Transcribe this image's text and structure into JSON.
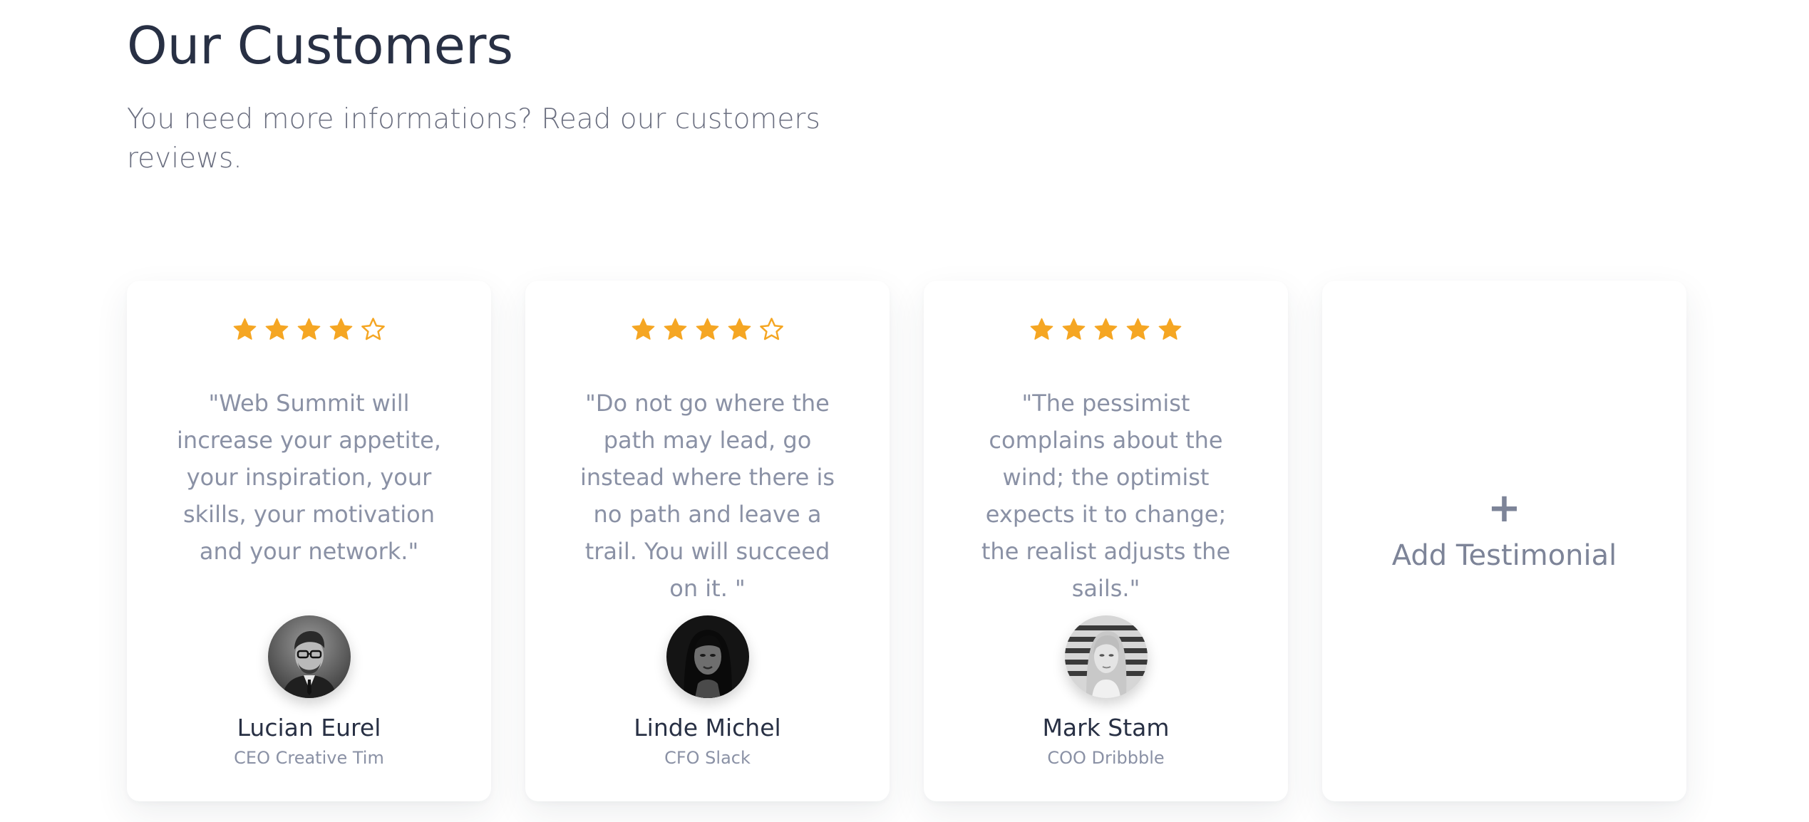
{
  "section": {
    "title": "Our Customers",
    "subtitle": "You need more informations? Read our customers reviews."
  },
  "colors": {
    "star": "#f5a623",
    "title": "#283044",
    "muted": "#8a91a5"
  },
  "testimonials": [
    {
      "rating": 4,
      "max_rating": 5,
      "quote": "\"Web Summit will increase your appetite, your inspiration, your skills, your motivation and your network.\"",
      "name": "Lucian Eurel",
      "role": "CEO Creative Tim",
      "avatar_icon": "avatar-man-glasses"
    },
    {
      "rating": 4,
      "max_rating": 5,
      "quote": "\"Do not go where the path may lead, go instead where there is no path and leave a trail. You will succeed on it. \"",
      "name": "Linde Michel",
      "role": "CFO Slack",
      "avatar_icon": "avatar-woman-dark"
    },
    {
      "rating": 5,
      "max_rating": 5,
      "quote": "\"The pessimist complains about the wind; the optimist expects it to change; the realist adjusts the sails.\"",
      "name": "Mark Stam",
      "role": "COO Dribbble",
      "avatar_icon": "avatar-woman-blonde"
    }
  ],
  "add_card": {
    "icon": "plus-icon",
    "plus_glyph": "+",
    "label": "Add Testimonial"
  }
}
